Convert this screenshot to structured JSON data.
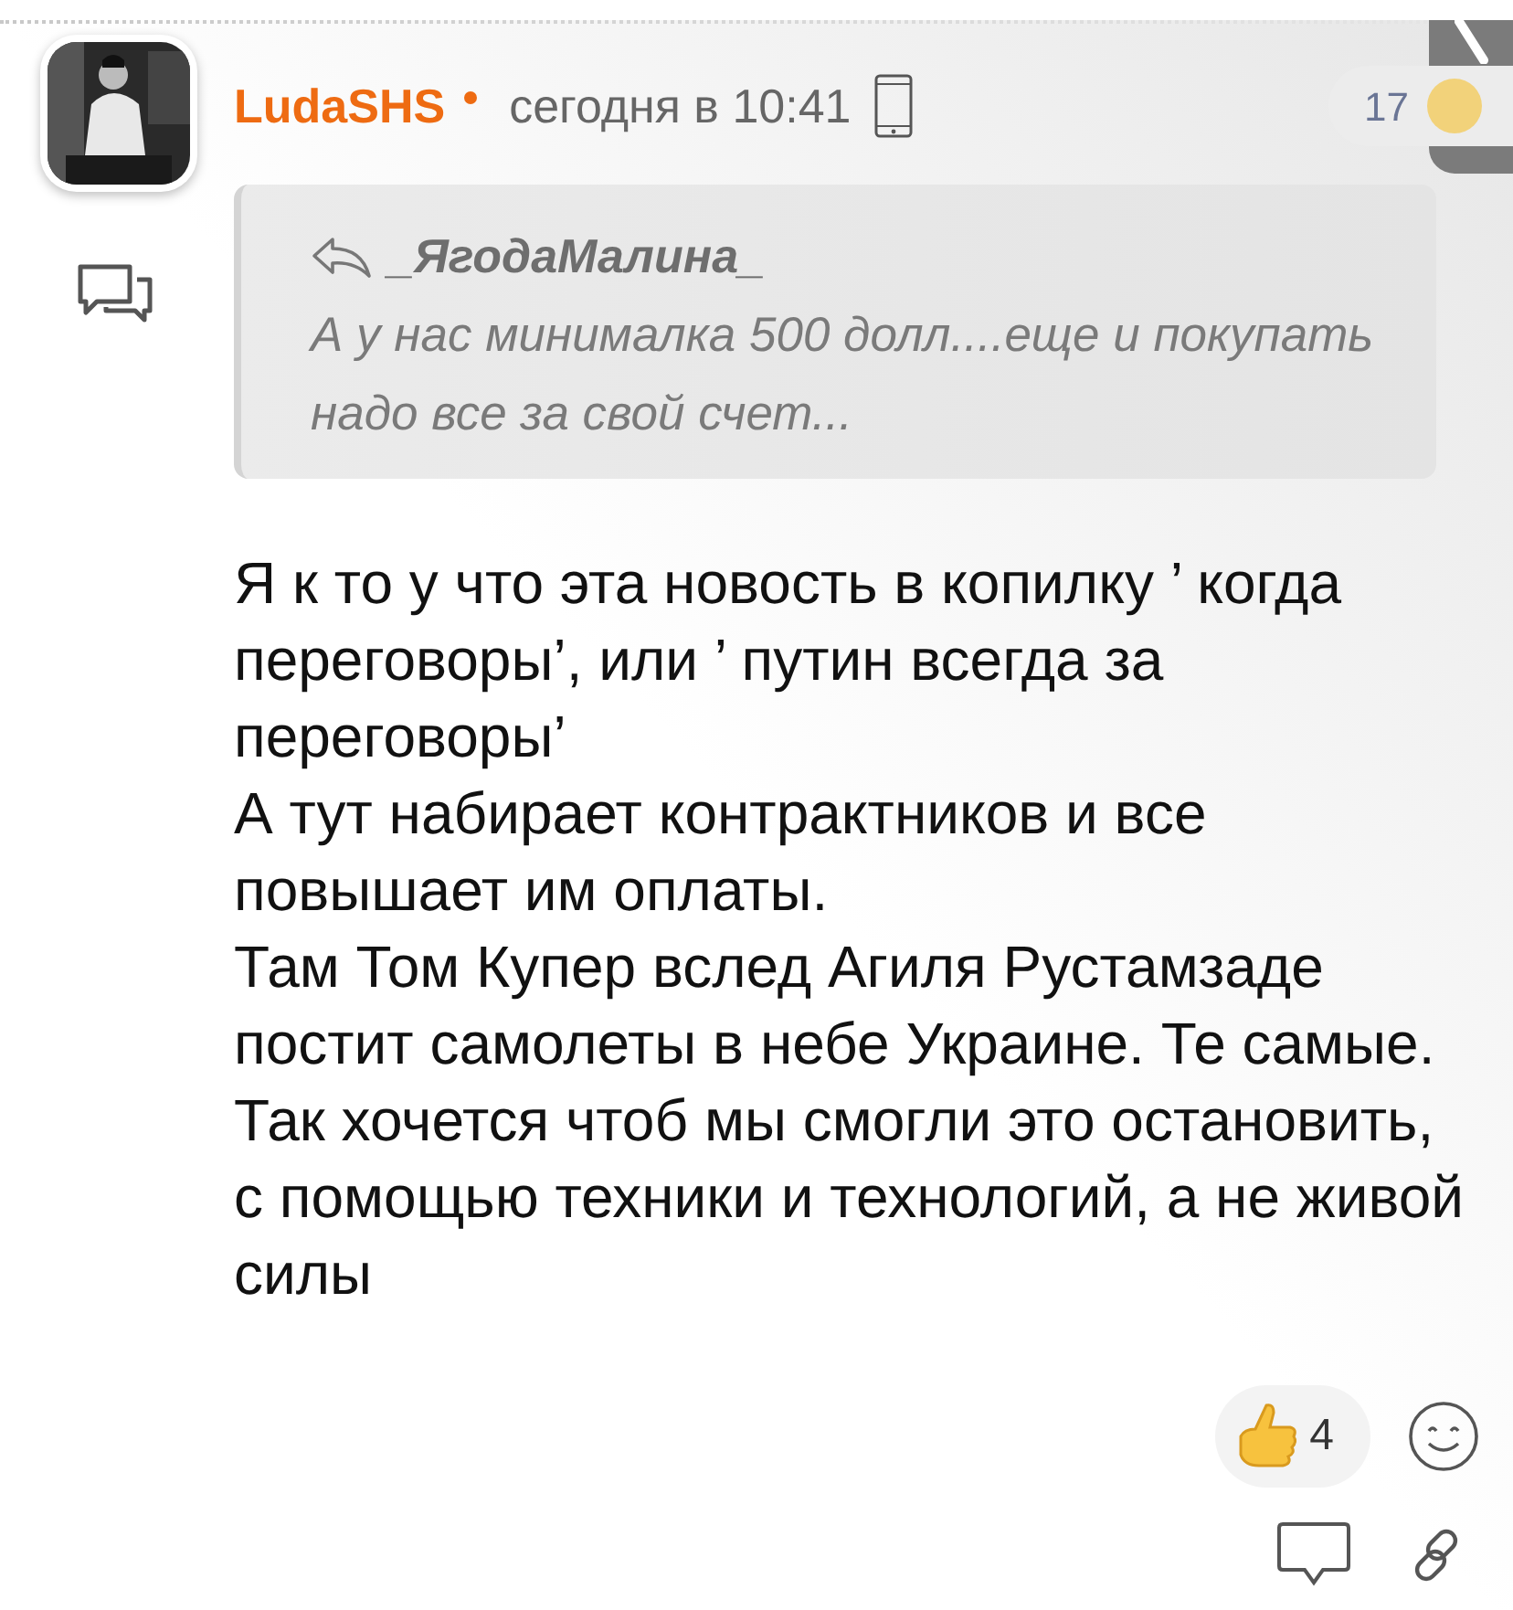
{
  "author": {
    "name": "LudaSHS",
    "online": true
  },
  "time": "сегодня в 10:41",
  "counter": "17",
  "quote": {
    "author": "_ЯгодаМалина_",
    "text": "А у нас минималка 500 долл....еще и покупать надо все за свой счет..."
  },
  "body": [
    "Я к то у что эта новость в копилку ’ когда переговоры’, или ’ путин всегда за переговоры’",
    "А тут набирает контрактников и все повышает им оплаты.",
    "Там Том Купер вслед Агиля Рустамзаде постит самолеты в небе Украине. Те самые.",
    "Так хочется чтоб мы смогли это остановить, с помощью техники и технологий, а не живой силы"
  ],
  "reactions": {
    "count": "4"
  }
}
